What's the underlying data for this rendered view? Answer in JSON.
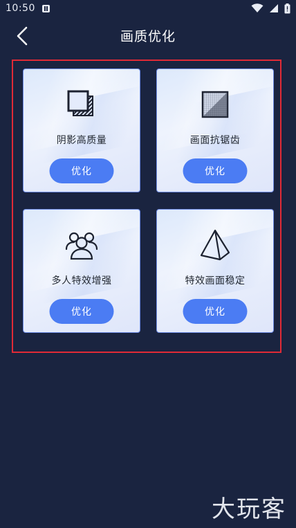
{
  "status_bar": {
    "time": "10:50",
    "icons": [
      "notification-icon",
      "wifi-icon",
      "signal-icon",
      "battery-icon"
    ]
  },
  "header": {
    "title": "画质优化",
    "back_icon": "chevron-left-icon"
  },
  "cards": [
    {
      "label": "阴影高质量",
      "icon": "shadow-quality-icon",
      "button": "优化"
    },
    {
      "label": "画面抗锯齿",
      "icon": "anti-aliasing-icon",
      "button": "优化"
    },
    {
      "label": "多人特效增强",
      "icon": "multi-user-icon",
      "button": "优化"
    },
    {
      "label": "特效画面稳定",
      "icon": "pyramid-icon",
      "button": "优化"
    }
  ],
  "watermark": "大玩客",
  "colors": {
    "background": "#1a2440",
    "button": "#4b7cf3",
    "highlight": "#e12a36"
  }
}
